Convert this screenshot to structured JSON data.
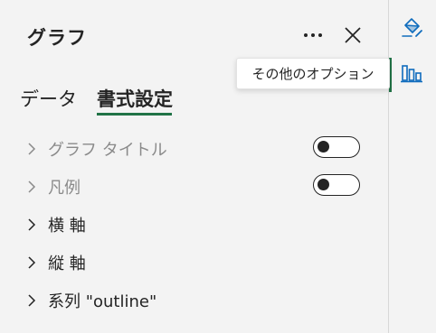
{
  "pane": {
    "title": "グラフ",
    "more_tooltip": "その他のオプション"
  },
  "tabs": [
    {
      "label": "データ",
      "selected": false
    },
    {
      "label": "書式設定",
      "selected": true
    }
  ],
  "sections": [
    {
      "label": "グラフ タイトル",
      "enabled": false,
      "toggle": "off"
    },
    {
      "label": "凡例",
      "enabled": false,
      "toggle": "off"
    },
    {
      "label": "横 軸",
      "enabled": true
    },
    {
      "label": "縦 軸",
      "enabled": true
    },
    {
      "label": "系列 \"outline\"",
      "enabled": true
    }
  ],
  "rail": {
    "icons": [
      "format-paint-icon",
      "chart-icon"
    ]
  },
  "colors": {
    "accent_green": "#217346",
    "rail_icon_blue": "#0f6cbd",
    "background": "#f3f3f3"
  }
}
